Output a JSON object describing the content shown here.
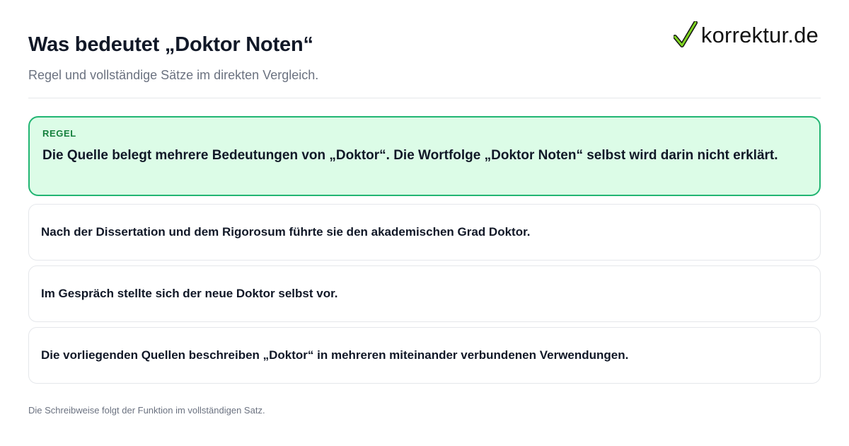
{
  "header": {
    "title": "Was bedeutet „Doktor Noten“",
    "subtitle": "Regel und vollständige Sätze im direkten Vergleich."
  },
  "logo": {
    "text": "korrektur.de",
    "icon": "checkmark-icon",
    "accent": "#7ed321"
  },
  "rule": {
    "label": "REGEL",
    "text": "Die Quelle belegt mehrere Bedeutungen von „Doktor“. Die Wortfolge „Doktor Noten“ selbst wird darin nicht erklärt."
  },
  "examples": [
    "Nach der Dissertation und dem Rigorosum führte sie den akademischen Grad Doktor.",
    "Im Gespräch stellte sich der neue Doktor selbst vor.",
    "Die vorliegenden Quellen beschreiben „Doktor“ in mehreren miteinander verbundenen Verwendungen."
  ],
  "footer": {
    "note": "Die Schreibweise folgt der Funktion im vollständigen Satz."
  },
  "colors": {
    "rule_background": "#dcfce7",
    "rule_border": "#22b573",
    "rule_label": "#15803d"
  }
}
